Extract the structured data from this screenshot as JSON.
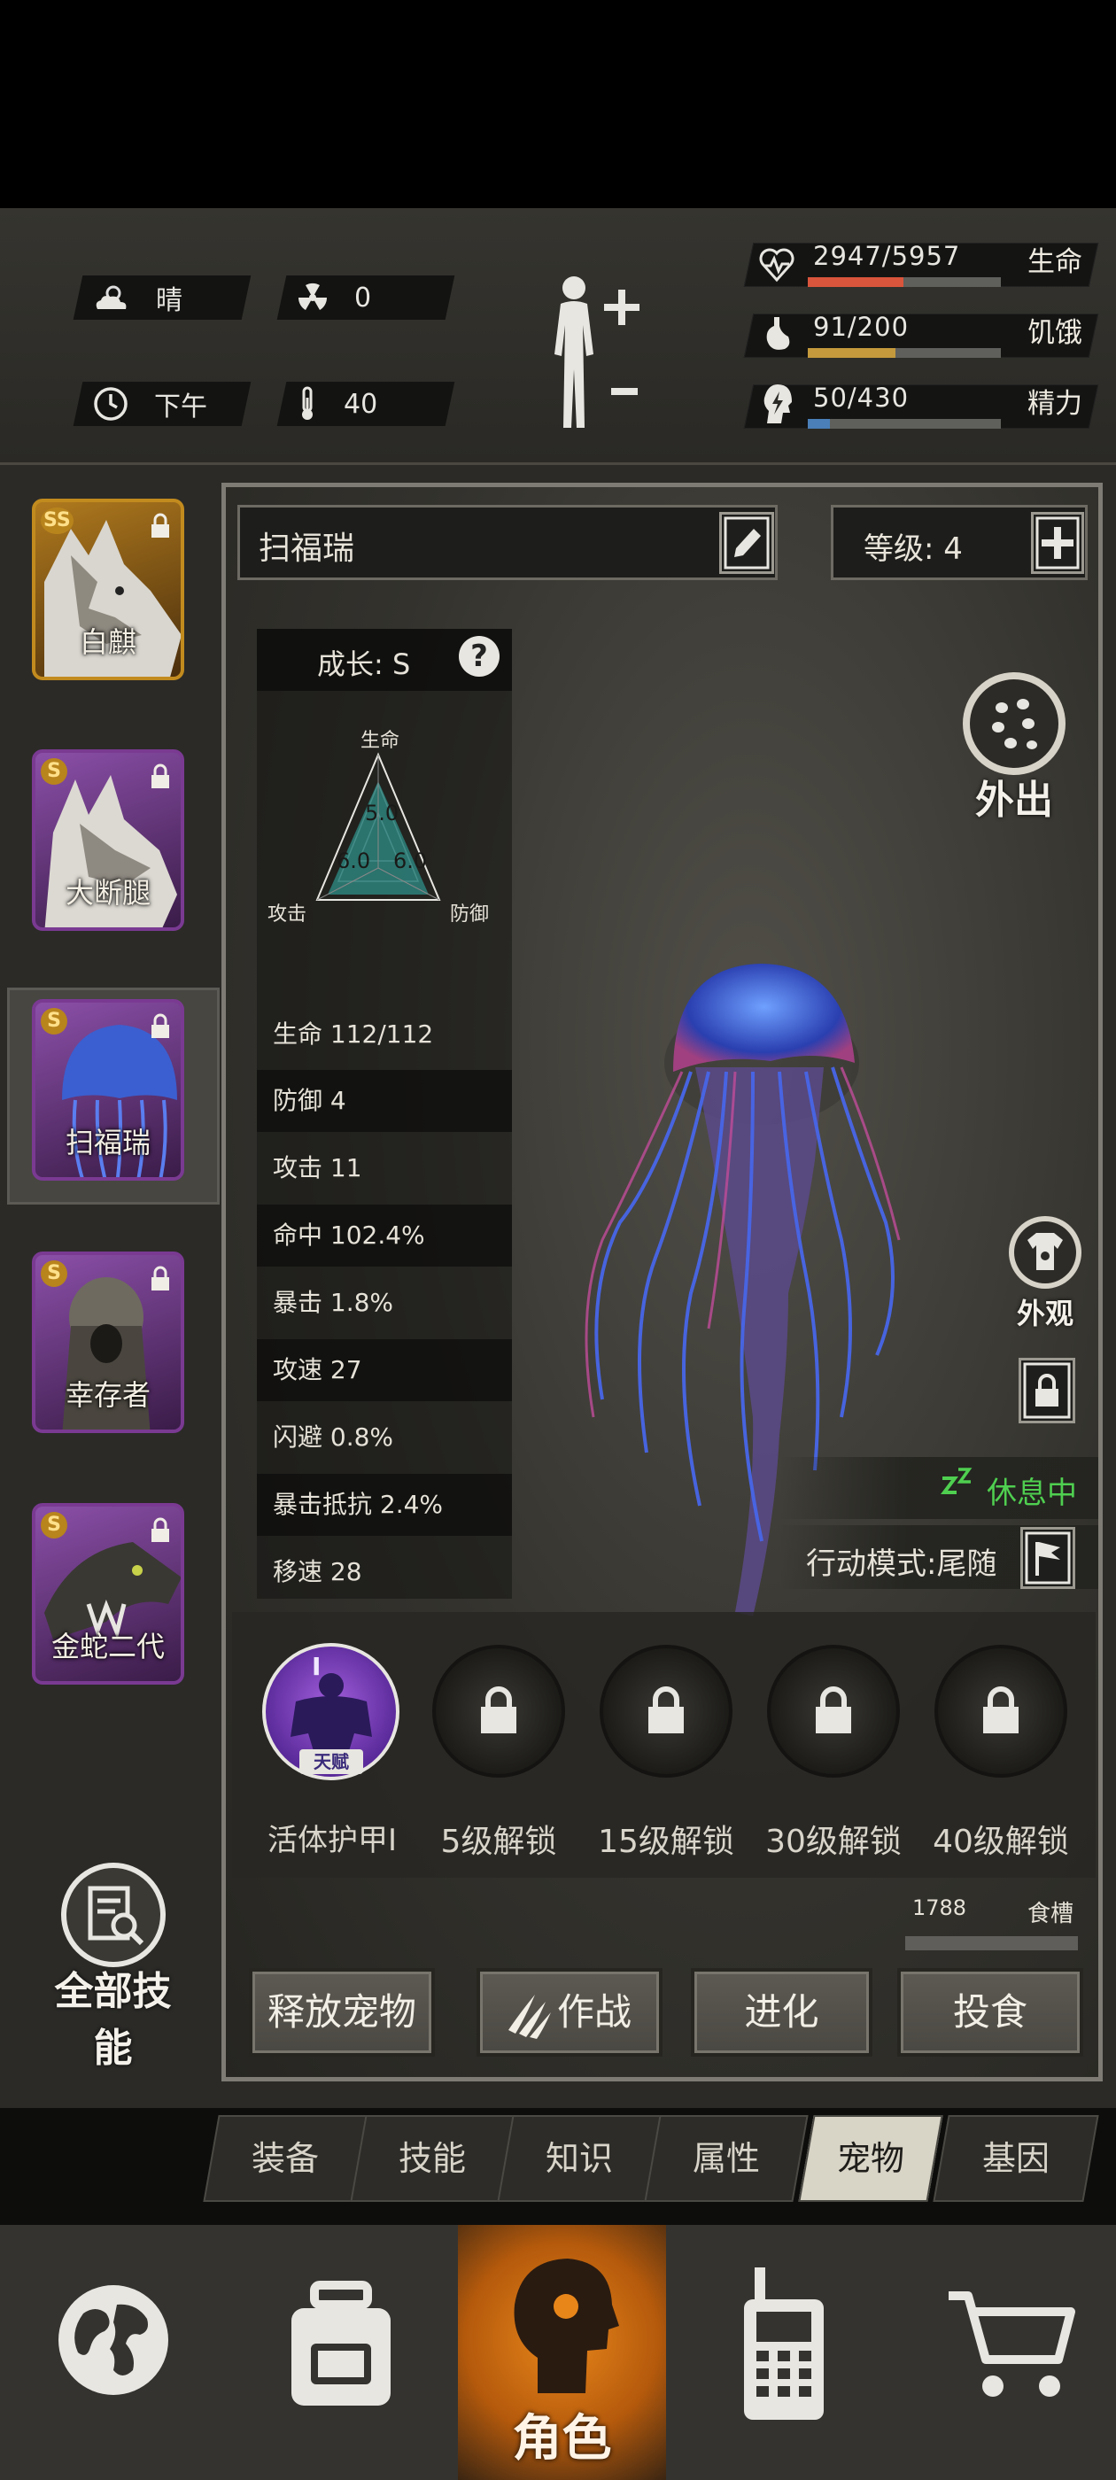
{
  "status": {
    "weather": "晴",
    "radiation": "0",
    "time_of_day": "下午",
    "temperature": "40",
    "health": {
      "text": "2947/5957",
      "label": "生命",
      "fraction": 0.495,
      "color": "#d9553c"
    },
    "hunger": {
      "text": "91/200",
      "label": "饥饿",
      "fraction": 0.455,
      "color": "#c49a3c"
    },
    "energy": {
      "text": "50/430",
      "label": "精力",
      "fraction": 0.116,
      "color": "#4a7fb8"
    }
  },
  "pets": [
    {
      "name": "白麒",
      "rank": "SS"
    },
    {
      "name": "大断腿",
      "rank": "S"
    },
    {
      "name": "扫福瑞",
      "rank": "S"
    },
    {
      "name": "幸存者",
      "rank": "S"
    },
    {
      "name": "金蛇二代",
      "rank": "S"
    }
  ],
  "all_skills_label": "全部技能",
  "pet_detail": {
    "name": "扫福瑞",
    "level_text": "等级:  4",
    "growth": "成长: S",
    "help": "?",
    "radar": {
      "top_label": "生命",
      "left_label": "攻击",
      "right_label": "防御",
      "top_value": "5.0",
      "left_value": "6.0",
      "right_value": "6.0"
    },
    "stats": [
      "生命  112/112",
      "防御  4",
      "攻击  11",
      "命中  102.4%",
      "暴击  1.8%",
      "攻速  27",
      "闪避  0.8%",
      "暴击抵抗  2.4%",
      "移速  28"
    ],
    "outing_label": "外出",
    "appearance_label": "外观",
    "rest_status": "休息中",
    "action_mode": "行动模式:尾随",
    "skills": [
      {
        "label": "活体护甲Ⅰ",
        "badge": "天赋",
        "numeral": "I"
      },
      {
        "label": "5级解锁"
      },
      {
        "label": "15级解锁"
      },
      {
        "label": "30级解锁"
      },
      {
        "label": "40级解锁"
      }
    ],
    "food_value": "1788",
    "food_label": "食槽",
    "buttons": {
      "release": "释放宠物",
      "fight": "作战",
      "evolve": "进化",
      "feed": "投食"
    }
  },
  "tabs": [
    "装备",
    "技能",
    "知识",
    "属性",
    "宠物",
    "基因"
  ],
  "active_tab": "宠物",
  "bottom_nav": {
    "character_label": "角色"
  },
  "colors": {
    "accent_green": "#49c45a",
    "rest_green": "#4fcf50",
    "character_orange": "#e07a12"
  }
}
